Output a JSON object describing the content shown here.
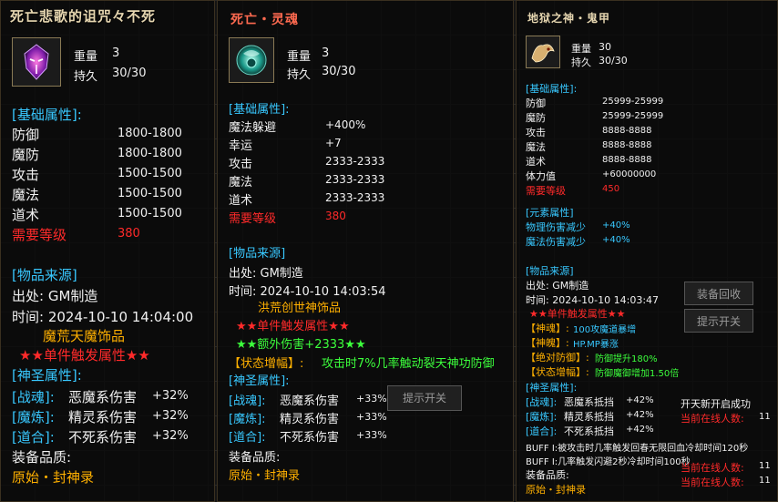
{
  "panel1": {
    "title": "死亡悲歌的诅咒々不死",
    "weight_label": "重量",
    "weight_value": "3",
    "durability_label": "持久",
    "durability_value": "30/30",
    "base_header": "[基础属性]:",
    "stats": [
      {
        "label": "防御",
        "value": "1800-1800"
      },
      {
        "label": "魔防",
        "value": "1800-1800"
      },
      {
        "label": "攻击",
        "value": "1500-1500"
      },
      {
        "label": "魔法",
        "value": "1500-1500"
      },
      {
        "label": "道术",
        "value": "1500-1500"
      }
    ],
    "req_label": "需要等级",
    "req_value": "380",
    "source_header": "[物品来源]",
    "origin": "出处: GM制造",
    "time": "时间: 2024-10-10 14:04:00",
    "series": "魔荒天魔饰品",
    "trigger": "★★单件触发属性★★",
    "holy_header": "[神圣属性]:",
    "holy": [
      {
        "tag": "[战魂]:",
        "text": "恶魔系伤害",
        "bonus": "+32%"
      },
      {
        "tag": "[魔炼]:",
        "text": "精灵系伤害",
        "bonus": "+32%"
      },
      {
        "tag": "[道合]:",
        "text": "不死系伤害",
        "bonus": "+32%"
      }
    ],
    "quality_label": "装备品质:",
    "quality_value": "原始・封神录"
  },
  "panel2": {
    "title": "死亡・灵魂",
    "weight_label": "重量",
    "weight_value": "3",
    "durability_label": "持久",
    "durability_value": "30/30",
    "base_header": "[基础属性]:",
    "stats": [
      {
        "label": "魔法躲避",
        "value": "+400%"
      },
      {
        "label": "幸运",
        "value": "+7"
      },
      {
        "label": "攻击",
        "value": "2333-2333"
      },
      {
        "label": "魔法",
        "value": "2333-2333"
      },
      {
        "label": "道术",
        "value": "2333-2333"
      }
    ],
    "req_label": "需要等级",
    "req_value": "380",
    "source_header": "[物品来源]",
    "origin": "出处: GM制造",
    "time": "时间: 2024-10-10 14:03:54",
    "series": "洪荒创世神饰品",
    "trigger": "★★单件触发属性★★",
    "extra": "★★额外伤害+2333★★",
    "state_tag": "【状态增幅】:",
    "state_text": "攻击时7%几率触动裂天神功防御",
    "holy_header": "[神圣属性]:",
    "holy": [
      {
        "tag": "[战魂]:",
        "text": "恶魔系伤害",
        "bonus": "+33%"
      },
      {
        "tag": "[魔炼]:",
        "text": "精灵系伤害",
        "bonus": "+33%"
      },
      {
        "tag": "[道合]:",
        "text": "不死系伤害",
        "bonus": "+33%"
      }
    ],
    "quality_label": "装备品质:",
    "quality_value": "原始・封神录",
    "button_hint": "提示开关"
  },
  "panel3": {
    "title": "地狱之神・鬼甲",
    "weight_label": "重量",
    "weight_value": "30",
    "durability_label": "持久",
    "durability_value": "30/30",
    "base_header": "[基础属性]:",
    "stats": [
      {
        "label": "防御",
        "value": "25999-25999"
      },
      {
        "label": "魔防",
        "value": "25999-25999"
      },
      {
        "label": "攻击",
        "value": "8888-8888"
      },
      {
        "label": "魔法",
        "value": "8888-8888"
      },
      {
        "label": "道术",
        "value": "8888-8888"
      },
      {
        "label": "体力值",
        "value": "+60000000"
      }
    ],
    "req_label": "需要等级",
    "req_value": "450",
    "elem_header": "[元素属性]",
    "elems": [
      {
        "label": "物理伤害减少",
        "value": "+40%"
      },
      {
        "label": "魔法伤害减少",
        "value": "+40%"
      }
    ],
    "source_header": "[物品来源]",
    "origin": "出处: GM制造",
    "time": "时间: 2024-10-10 14:03:47",
    "trigger": "★★单件触发属性★★",
    "lines": [
      {
        "tag": "【神魂】:",
        "text": "100攻魔道暴增"
      },
      {
        "tag": "【神魄】:",
        "text": "HP.MP暴涨"
      },
      {
        "tag": "【绝对防御】:",
        "text": "防御提升180%"
      },
      {
        "tag": "【状态增幅】:",
        "text": "防御魔御增加1.50倍"
      }
    ],
    "holy_header": "[神圣属性]:",
    "holy": [
      {
        "tag": "[战魂]:",
        "text": "恶魔系抵挡",
        "bonus": "+42%"
      },
      {
        "tag": "[魔炼]:",
        "text": "精灵系抵挡",
        "bonus": "+42%"
      },
      {
        "tag": "[道合]:",
        "text": "不死系抵挡",
        "bonus": "+42%"
      }
    ],
    "buff1": "BUFF I:被攻击时几率触发回春无限回血冷却时间120秒",
    "buff2": "BUFF I:几率触发闪避2秒冷却时间100秒",
    "quality_label": "装备品质:",
    "quality_value": "原始・封神录",
    "buttons": [
      "装备回收",
      "提示开关"
    ],
    "online": [
      {
        "label": "当前在线人数:",
        "value": "11"
      },
      {
        "label": "当前在线人数:",
        "value": "11"
      },
      {
        "label": "当前在线人数:",
        "value": "11"
      }
    ],
    "side_notice": "开天新开启成功"
  },
  "colors": {
    "header": "#38c8ff",
    "requirement": "#ff2a2a",
    "series": "#ffb000",
    "trigger": "#ff2a2a",
    "extra": "#3cff3c"
  }
}
